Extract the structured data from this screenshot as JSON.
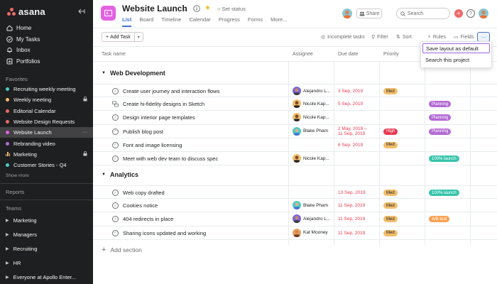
{
  "colors": {
    "sidebar_bg": "#1e1f21",
    "accent_blue": "#4573d2",
    "project_icon": "#e362e3",
    "overdue_red": "#e8384f",
    "menu_focus": "#9b63e3"
  },
  "app": {
    "brand": "asana"
  },
  "sidebar": {
    "nav": [
      {
        "label": "Home",
        "icon": "home-icon"
      },
      {
        "label": "My Tasks",
        "icon": "check-circle-icon"
      },
      {
        "label": "Inbox",
        "icon": "bell-icon"
      },
      {
        "label": "Portfolios",
        "icon": "chart-icon"
      }
    ],
    "favorites_label": "Favorites",
    "favorites": [
      {
        "label": "Recruiting weekly meeting",
        "color": "#4ecbc4"
      },
      {
        "label": "Weekly meeting",
        "color": "#f1bd6c",
        "locked": true
      },
      {
        "label": "Editorial Calendar",
        "color": "#f06a6a"
      },
      {
        "label": "Website Design Requests",
        "color": "#f06a6a"
      },
      {
        "label": "Website Launch",
        "color": "#e362e3",
        "active": true,
        "trail": "···"
      },
      {
        "label": "Rebranding video",
        "color": "#b36bd4"
      },
      {
        "label": "Marketing",
        "color": "#f1bd6c",
        "bars": true,
        "locked": true
      },
      {
        "label": "Customer Stories - Q4",
        "color": "#4ecbc4"
      }
    ],
    "show_more": "Show more",
    "reports_label": "Reports",
    "teams_label": "Teams",
    "teams": [
      "Marketing",
      "Managers",
      "Recruiting",
      "HR",
      "Everyone at Apollo Enter..."
    ]
  },
  "header": {
    "title": "Website Launch",
    "set_status": "Set status",
    "tabs": [
      "List",
      "Board",
      "Timeline",
      "Calendar",
      "Progress",
      "Forms",
      "More..."
    ],
    "active_tab": 0,
    "share": "Share",
    "search_placeholder": "Search",
    "help": "?"
  },
  "toolbar": {
    "add_task": "Add Task",
    "incomplete": "Incomplete tasks",
    "filter": "Filter",
    "sort": "Sort",
    "rules": "Rules",
    "fields": "Fields",
    "more": "···"
  },
  "columns": {
    "task": "Task name",
    "assignee": "Assignee",
    "due": "Due date",
    "priority": "Priority"
  },
  "sections": [
    {
      "title": "Web Development",
      "rows": [
        {
          "name": "Create user journey and interaction flows",
          "assignee": "Alejandro L...",
          "avatar": "a1",
          "due": "3 Sep, 2019",
          "priority": "Med",
          "stage": ""
        },
        {
          "name": "Create hi-fidelity designs in Sketch",
          "assignee": "Nicole Kap...",
          "avatar": "a2",
          "due": "5 Sep, 2019",
          "priority": "",
          "stage": "Planning",
          "icon": "subtask"
        },
        {
          "name": "Design interior page templates",
          "assignee": "Nicole Kap...",
          "avatar": "a2",
          "due": "",
          "priority": "",
          "stage": "Planning"
        },
        {
          "name": "Publish blog post",
          "assignee": "Blake Pham",
          "avatar": "a3",
          "due": "2 May, 2019 – 11 Sep, 2019",
          "priority": "High",
          "stage": "Planning"
        },
        {
          "name": "Font and image licensing",
          "assignee": "",
          "avatar": "",
          "due": "6 Sep, 2019",
          "priority": "Med",
          "stage": ""
        },
        {
          "name": "Meet with web dev team to discuss spec",
          "assignee": "Nicole Kap...",
          "avatar": "a2",
          "due": "",
          "priority": "",
          "stage": "100% launch"
        }
      ]
    },
    {
      "title": "Analytics",
      "rows": [
        {
          "name": "Web copy drafted",
          "assignee": "",
          "avatar": "",
          "due": "13 Sep, 2019",
          "priority": "Med",
          "stage": "100% launch"
        },
        {
          "name": "Cookies notice",
          "assignee": "Blake Pham",
          "avatar": "a3",
          "due": "11 Sep, 2019",
          "priority": "Med",
          "stage": ""
        },
        {
          "name": "404 redirects in place",
          "assignee": "Alejandro L...",
          "avatar": "a1",
          "due": "11 Sep, 2019",
          "priority": "Med",
          "stage": "A/B test"
        },
        {
          "name": "Sharing icons updated and working",
          "assignee": "Kat Mooney",
          "avatar": "a4",
          "due": "11 Sep, 2019",
          "priority": "Med",
          "stage": ""
        }
      ]
    }
  ],
  "add_section": "Add section",
  "menu": {
    "items": [
      "Save layout as default",
      "Search this project"
    ],
    "focused": 0
  }
}
